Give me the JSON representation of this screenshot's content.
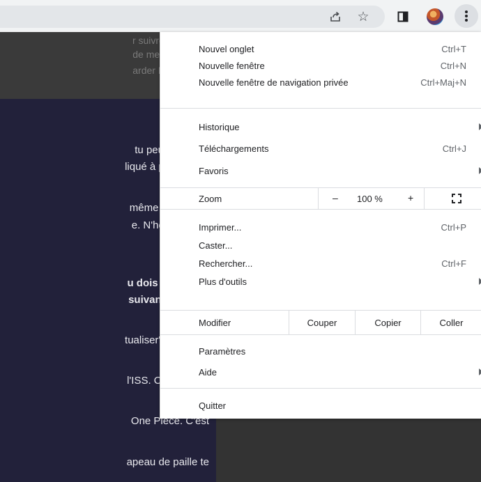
{
  "page": {
    "banner_lines": [
      "r suivre l'aventure",
      "de merveilleux de",
      "arder Dragon Ball"
    ],
    "content_lines": [
      {
        "text": "tu peux faire tes",
        "bold": false
      },
      {
        "text": "liqué à prendre en",
        "bold": false
      },
      {
        "text": "même onglet, les",
        "bold": false
      },
      {
        "text": "e. N'hésite pas à",
        "bold": false
      },
      {
        "text": "u dois te trouver",
        "bold": true
      },
      {
        "text": "suivantes. (case",
        "bold": true
      },
      {
        "text": "tualiser\". Ta feuille",
        "bold": false
      },
      {
        "text": "l'ISS. On retombe",
        "bold": false
      },
      {
        "text": "One Piece. C'est",
        "bold": false
      },
      {
        "text": "apeau de paille te",
        "bold": false
      }
    ]
  },
  "toolbar": {
    "icons": [
      "share-icon",
      "star-icon",
      "side-panel-icon",
      "avatar",
      "kebab-menu-icon"
    ]
  },
  "menu": {
    "new_tab": {
      "label": "Nouvel onglet",
      "shortcut": "Ctrl+T"
    },
    "new_window": {
      "label": "Nouvelle fenêtre",
      "shortcut": "Ctrl+N"
    },
    "new_incognito": {
      "label": "Nouvelle fenêtre de navigation privée",
      "shortcut": "Ctrl+Maj+N"
    },
    "history": {
      "label": "Historique"
    },
    "downloads": {
      "label": "Téléchargements",
      "shortcut": "Ctrl+J"
    },
    "bookmarks": {
      "label": "Favoris"
    },
    "zoom": {
      "label": "Zoom",
      "minus": "–",
      "value": "100 %",
      "plus": "+"
    },
    "print": {
      "label": "Imprimer...",
      "shortcut": "Ctrl+P"
    },
    "cast": {
      "label": "Caster..."
    },
    "find": {
      "label": "Rechercher...",
      "shortcut": "Ctrl+F"
    },
    "more_tools": {
      "label": "Plus d'outils"
    },
    "edit": {
      "label": "Modifier",
      "cut": "Couper",
      "copy": "Copier",
      "paste": "Coller"
    },
    "settings": {
      "label": "Paramètres"
    },
    "help": {
      "label": "Aide"
    },
    "exit": {
      "label": "Quitter"
    }
  },
  "colors": {
    "toolbar_bg": "#f1f3f4",
    "page_dark": "#22213a",
    "page_gray": "#333333",
    "menu_text": "#202124",
    "shortcut_text": "#5f6368"
  }
}
